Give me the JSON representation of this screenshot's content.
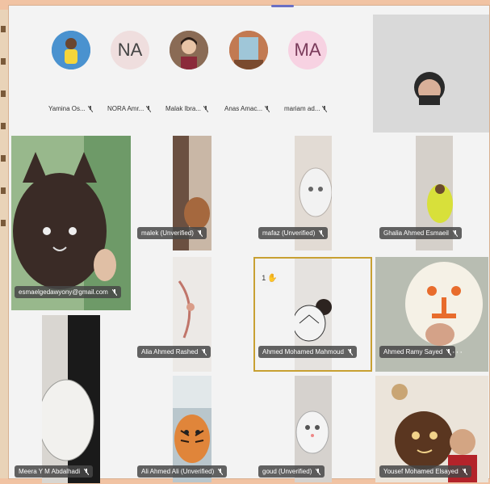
{
  "avatars": [
    {
      "name": "Yamina Os...",
      "initials": "",
      "bg": "#3a86c8"
    },
    {
      "name": "NORA Amr...",
      "initials": "NA",
      "bg": "#efdede"
    },
    {
      "name": "Malak Ibra...",
      "initials": "",
      "bg": "#7a5a45"
    },
    {
      "name": "Anas Amac...",
      "initials": "",
      "bg": "#b0583a"
    },
    {
      "name": "mariam ad...",
      "initials": "MA",
      "bg": "#f7d2e2"
    }
  ],
  "tiles": [
    {
      "label": "esmaelgedawyony@gmail.com"
    },
    {
      "label": "malek (Unverified)"
    },
    {
      "label": "mafaz (Unverified)"
    },
    {
      "label": "Ghalia Ahmed Esmaeil"
    },
    {
      "label": "Alia Ahmed Rashed"
    },
    {
      "label": "Ahmed Mohamed Mahmoud"
    },
    {
      "label": "Ahmed Ramy Sayed"
    },
    {
      "label": "Meera Y M Abdalhadi"
    },
    {
      "label": "Ali Ahmed Ali (Unverified)"
    },
    {
      "label": "goud (Unverified)"
    },
    {
      "label": "Yousef Mohamed Elsayed"
    }
  ],
  "reaction": {
    "count": "1",
    "emoji": "✋"
  },
  "more_icon": "···",
  "colors": {
    "highlight": "#c8a032",
    "label_bg": "#464646",
    "frame": "#f1c3a3"
  }
}
